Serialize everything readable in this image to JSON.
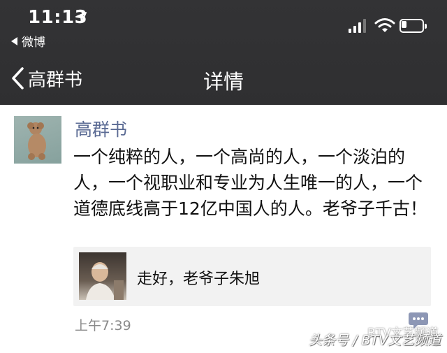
{
  "status_bar": {
    "time": "11:13",
    "back_app": "微博",
    "battery_level": 0.25
  },
  "nav": {
    "back_label": "高群书",
    "title": "详情"
  },
  "post": {
    "author": "高群书",
    "text": "一个纯粹的人，一个高尚的人，一个淡泊的人，一个视职业和专业为人生唯一的人，一个道德底线高于12亿中国人的人。老爷子千古！",
    "share_title": "走好，老爷子朱旭",
    "time": "上午7:39"
  },
  "watermark": {
    "main": "头条号 / BTV文艺频道",
    "top": "BTV文艺频道"
  },
  "colors": {
    "header_bg": "#333335",
    "author_link": "#5b6b94",
    "card_bg": "#f2f2f2",
    "time_gray": "#8a8a8a"
  },
  "icons": [
    "location-arrow-icon",
    "back-triangle-icon",
    "signal-icon",
    "wifi-icon",
    "battery-icon",
    "chevron-left-icon",
    "comment-icon",
    "watermark-logo-icon"
  ]
}
